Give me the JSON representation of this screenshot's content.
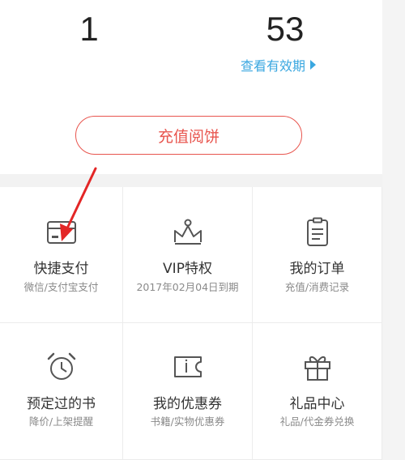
{
  "stats": {
    "left_value": "1",
    "right_value": "53",
    "validity_link": "查看有效期"
  },
  "recharge_button": "充值阅饼",
  "grid": {
    "items": [
      {
        "title": "快捷支付",
        "sub": "微信/支付宝支付",
        "icon": "card-icon"
      },
      {
        "title": "VIP特权",
        "sub": "2017年02月04日到期",
        "icon": "crown-icon"
      },
      {
        "title": "我的订单",
        "sub": "充值/消费记录",
        "icon": "clipboard-icon"
      },
      {
        "title": "预定过的书",
        "sub": "降价/上架提醒",
        "icon": "alarm-clock-icon"
      },
      {
        "title": "我的优惠券",
        "sub": "书籍/实物优惠券",
        "icon": "coupon-icon"
      },
      {
        "title": "礼品中心",
        "sub": "礼品/代金券兑换",
        "icon": "gift-icon"
      }
    ]
  },
  "colors": {
    "accent_red": "#e8554e",
    "link_blue": "#3aa7e0",
    "icon_gray": "#555555"
  }
}
